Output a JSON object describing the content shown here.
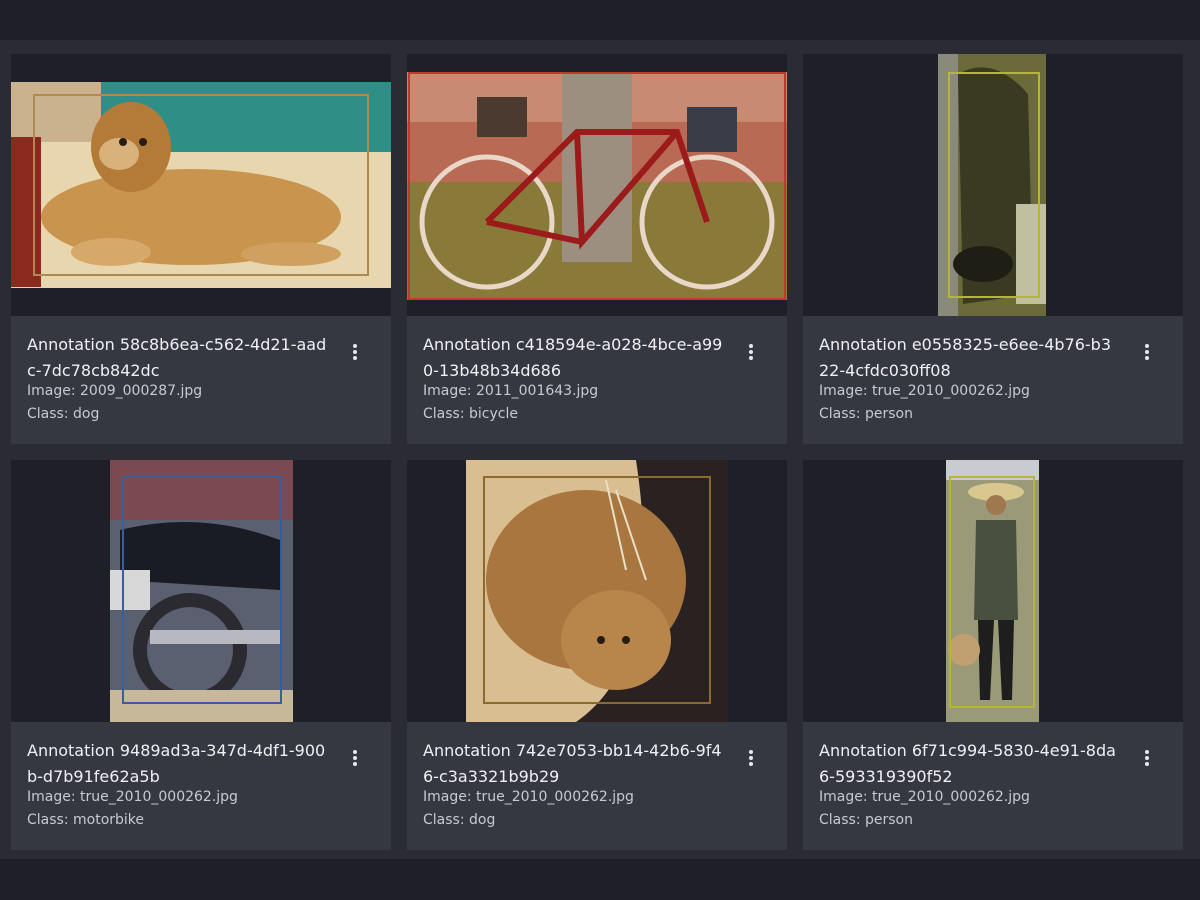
{
  "colors": {
    "background": "#1e1f27",
    "panel": "#2a2b33",
    "card": "#363841"
  },
  "cards": [
    {
      "title": "Annotation 58c8b6ea-c562-4d21-aadc-7dc78cb842dc",
      "image_label": "Image: 2009_000287.jpg",
      "class_label": "Class: dog",
      "menu_icon": "more-vert-icon",
      "box_color": "#b08a50"
    },
    {
      "title": "Annotation c418594e-a028-4bce-a990-13b48b34d686",
      "image_label": "Image: 2011_001643.jpg",
      "class_label": "Class: bicycle",
      "menu_icon": "more-vert-icon",
      "box_color": "#c0392b"
    },
    {
      "title": "Annotation e0558325-e6ee-4b76-b322-4cfdc030ff08",
      "image_label": "Image: true_2010_000262.jpg",
      "class_label": "Class: person",
      "menu_icon": "more-vert-icon",
      "box_color": "#b5b536"
    },
    {
      "title": "Annotation 9489ad3a-347d-4df1-900b-d7b91fe62a5b",
      "image_label": "Image: true_2010_000262.jpg",
      "class_label": "Class: motorbike",
      "menu_icon": "more-vert-icon",
      "box_color": "#3a5e9a"
    },
    {
      "title": "Annotation 742e7053-bb14-42b6-9f46-c3a3321b9b29",
      "image_label": "Image: true_2010_000262.jpg",
      "class_label": "Class: dog",
      "menu_icon": "more-vert-icon",
      "box_color": "#8a6a2e"
    },
    {
      "title": "Annotation 6f71c994-5830-4e91-8da6-593319390f52",
      "image_label": "Image: true_2010_000262.jpg",
      "class_label": "Class: person",
      "menu_icon": "more-vert-icon",
      "box_color": "#b5b536"
    }
  ]
}
